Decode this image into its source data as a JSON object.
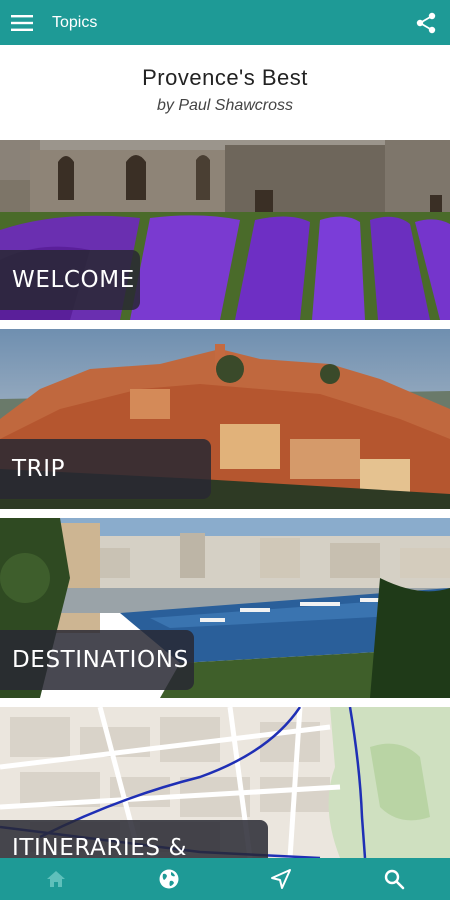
{
  "appbar": {
    "title": "Topics",
    "menu_icon": "hamburger-menu-icon",
    "share_icon": "share-icon",
    "color": "#1e9a96"
  },
  "header": {
    "title": "Provence's Best",
    "author": "by Paul Shawcross"
  },
  "topics": [
    {
      "label": "WELCOME",
      "image": "lavender-field-stone-abbey"
    },
    {
      "label": "TRIP ESSENTIALS",
      "image": "hilltop-village-ochre"
    },
    {
      "label": "DESTINATIONS",
      "image": "harbor-city-view"
    },
    {
      "label": "ITINERARIES & TOURS",
      "image": "street-map"
    }
  ],
  "bottomnav": {
    "items": [
      {
        "icon": "home-icon",
        "active": true
      },
      {
        "icon": "globe-icon",
        "active": false
      },
      {
        "icon": "navigation-arrow-icon",
        "active": false
      },
      {
        "icon": "search-icon",
        "active": false
      }
    ]
  }
}
